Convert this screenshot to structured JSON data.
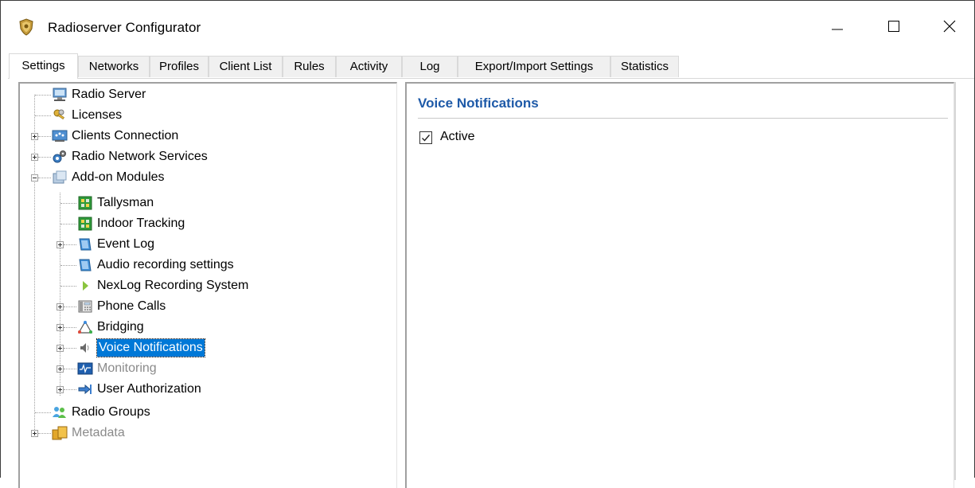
{
  "window": {
    "title": "Radioserver Configurator",
    "icon": "shield-emblem-icon"
  },
  "tabs": [
    {
      "label": "Settings",
      "active": true
    },
    {
      "label": "Networks"
    },
    {
      "label": "Profiles"
    },
    {
      "label": "Client List"
    },
    {
      "label": "Rules"
    },
    {
      "label": "Activity"
    },
    {
      "label": "Log"
    },
    {
      "label": "Export/Import Settings"
    },
    {
      "label": "Statistics"
    }
  ],
  "tree": {
    "items": [
      {
        "label": "Radio Server",
        "icon": "server-monitor-icon"
      },
      {
        "label": "Licenses",
        "icon": "keys-icon"
      },
      {
        "label": "Clients Connection",
        "icon": "network-icon",
        "expandable": true
      },
      {
        "label": "Radio Network Services",
        "icon": "gears-icon",
        "expandable": true
      },
      {
        "label": "Add-on Modules",
        "icon": "modules-icon",
        "expanded": true
      },
      {
        "label": "Tallysman",
        "icon": "circuit-board-icon"
      },
      {
        "label": "Indoor Tracking",
        "icon": "circuit-board-icon"
      },
      {
        "label": "Event Log",
        "icon": "log-book-icon",
        "expandable": true
      },
      {
        "label": "Audio recording settings",
        "icon": "log-book-icon"
      },
      {
        "label": "NexLog Recording System",
        "icon": "play-arrow-icon"
      },
      {
        "label": "Phone Calls",
        "icon": "phone-icon",
        "expandable": true
      },
      {
        "label": "Bridging",
        "icon": "bridge-triangle-icon",
        "expandable": true
      },
      {
        "label": "Voice Notifications",
        "icon": "speaker-icon",
        "expandable": true,
        "selected": true
      },
      {
        "label": "Monitoring",
        "icon": "monitor-graph-icon",
        "expandable": true,
        "disabled": true
      },
      {
        "label": "User Authorization",
        "icon": "login-arrow-icon",
        "expandable": true
      },
      {
        "label": "Radio Groups",
        "icon": "users-group-icon"
      },
      {
        "label": "Metadata",
        "icon": "folders-icon",
        "expandable": true,
        "disabled": true
      }
    ]
  },
  "detail": {
    "title": "Voice Notifications",
    "active_label": "Active",
    "active_checked": true
  },
  "colors": {
    "selection": "#0078d7",
    "section_title": "#1e5aa8"
  }
}
